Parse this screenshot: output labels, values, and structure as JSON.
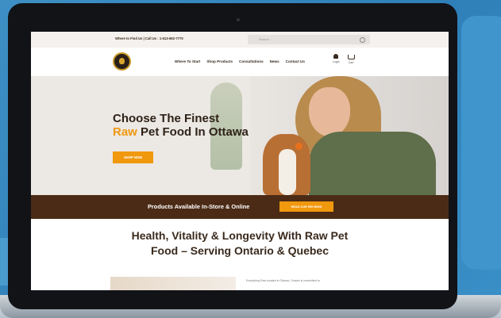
{
  "topbar": {
    "info": "Where to Find Us | Call Us : 1-613-692-7770",
    "search_placeholder": "Search..."
  },
  "nav": {
    "menu": [
      "Where To Start",
      "Shop Products",
      "Consultations",
      "News",
      "Contact Us"
    ],
    "account_label": "Login",
    "cart_label": "Cart"
  },
  "hero": {
    "headline_line1": "Choose The Finest",
    "headline_raw": "Raw",
    "headline_line2_rest": " Pet Food In Ottawa",
    "cta": "SHOP NOW"
  },
  "band": {
    "text": "Products Available In-Store & Online",
    "button": "READ OUR REVIEWS"
  },
  "section": {
    "headline_line1": "Health, Vitality & Longevity With Raw Pet",
    "headline_line2": "Food – Serving Ontario & Quebec",
    "paragraph": "Everything Raw located in Ottawa, Ontario is committed to"
  },
  "colors": {
    "accent": "#f0980e",
    "dark_brown": "#4b2b16",
    "background_blue": "#3d8fc4"
  }
}
